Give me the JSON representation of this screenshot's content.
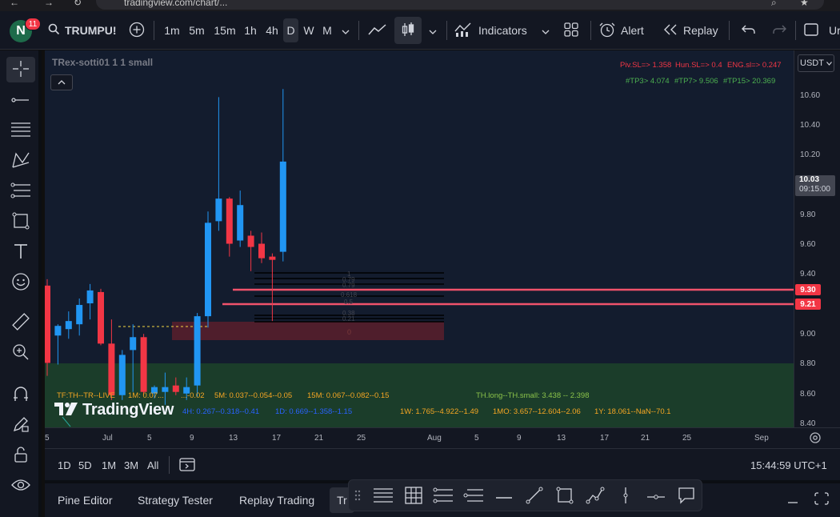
{
  "browser": {
    "url": "tradingview.com/chart/..."
  },
  "header": {
    "avatar_letter": "N",
    "notifications": "11",
    "symbol": "TRUMPU!",
    "intervals": [
      "1m",
      "5m",
      "15m",
      "1h",
      "4h",
      "D",
      "W",
      "M"
    ],
    "active_interval": "D",
    "indicators_label": "Indicators",
    "alert_label": "Alert",
    "replay_label": "Replay",
    "overflow_label": "Ur"
  },
  "chart": {
    "legend_title": "TRex-sotti01 1 1 small",
    "overlays": {
      "sl_line": [
        "Piv.SL=> 1.358",
        "Hun.SL=> 0.4",
        "ENG.sl=> 0.247"
      ],
      "tp_line": [
        "#TP3> 4.074",
        "#TP7> 9.506",
        "#TP15> 20.369"
      ],
      "tf_row1": [
        "TF:TH--TR--LIVE",
        "1M: 0.07...",
        "...-0.02",
        "5M: 0.037--0.054--0.05",
        "15M: 0.067--0.082--0.15",
        "TH.long--TH.small: 3.438 -- 2.398"
      ],
      "tf_row2": [
        "4H: 0.267--0.318--0.41",
        "1D: 0.669--1.358--1.15",
        "1W: 1.765--4.922--1.49",
        "1MO: 3.657--12.604--2.06",
        "1Y: 18.061--NaN--70.1"
      ],
      "fib_labels": [
        "1",
        "0.79",
        "0.79",
        "0.618",
        "0.5",
        "0.38",
        "0.21",
        "0"
      ]
    },
    "watermark": "TradingView",
    "price_axis": {
      "currency": "USDT",
      "ticks": [
        "10.60",
        "10.40",
        "10.20",
        "9.80",
        "9.60",
        "9.40",
        "9.00",
        "8.80",
        "8.60",
        "8.40"
      ],
      "current_price": "10.03",
      "current_time": "09:15:00",
      "tag_upper": "9.30",
      "tag_lower": "9.21"
    },
    "time_axis": [
      "5",
      "Jul",
      "5",
      "9",
      "13",
      "17",
      "21",
      "25",
      "Aug",
      "5",
      "9",
      "13",
      "17",
      "21",
      "25",
      "Sep"
    ]
  },
  "chart_data": {
    "type": "candlestick",
    "title": "",
    "ylim": [
      8.38,
      10.72
    ],
    "up_color": "#2196f3",
    "down_color": "#f23645",
    "candles": [
      {
        "o": 9.26,
        "h": 9.3,
        "l": 8.7,
        "c": 8.78
      },
      {
        "o": 8.95,
        "h": 9.02,
        "l": 8.77,
        "c": 9.01
      },
      {
        "o": 8.99,
        "h": 9.1,
        "l": 8.93,
        "c": 9.04
      },
      {
        "o": 9.02,
        "h": 9.18,
        "l": 8.95,
        "c": 9.14
      },
      {
        "o": 9.15,
        "h": 9.27,
        "l": 9.05,
        "c": 9.23
      },
      {
        "o": 9.22,
        "h": 9.24,
        "l": 8.89,
        "c": 8.9
      },
      {
        "o": 8.9,
        "h": 9.05,
        "l": 8.55,
        "c": 8.58
      },
      {
        "o": 8.58,
        "h": 8.86,
        "l": 8.55,
        "c": 8.83
      },
      {
        "o": 8.86,
        "h": 9.02,
        "l": 8.6,
        "c": 8.94
      },
      {
        "o": 8.94,
        "h": 8.96,
        "l": 8.58,
        "c": 8.6
      },
      {
        "o": 8.59,
        "h": 8.64,
        "l": 8.56,
        "c": 8.63
      },
      {
        "o": 8.6,
        "h": 8.72,
        "l": 8.52,
        "c": 8.63
      },
      {
        "o": 8.64,
        "h": 8.69,
        "l": 8.58,
        "c": 8.6
      },
      {
        "o": 8.59,
        "h": 8.69,
        "l": 8.55,
        "c": 8.63
      },
      {
        "o": 8.64,
        "h": 9.09,
        "l": 8.57,
        "c": 9.07
      },
      {
        "o": 9.07,
        "h": 9.72,
        "l": 9.0,
        "c": 9.65
      },
      {
        "o": 9.66,
        "h": 10.43,
        "l": 9.6,
        "c": 9.8
      },
      {
        "o": 9.8,
        "h": 9.81,
        "l": 9.44,
        "c": 9.52
      },
      {
        "o": 9.54,
        "h": 9.85,
        "l": 9.5,
        "c": 9.76
      },
      {
        "o": 9.57,
        "h": 9.6,
        "l": 9.35,
        "c": 9.5
      },
      {
        "o": 9.52,
        "h": 9.59,
        "l": 9.4,
        "c": 9.43
      },
      {
        "o": 9.44,
        "h": 9.46,
        "l": 9.04,
        "c": 9.42
      },
      {
        "o": 9.47,
        "h": 10.48,
        "l": 9.41,
        "c": 10.03
      }
    ]
  },
  "range_bar": {
    "ranges": [
      "1D",
      "5D",
      "1M",
      "3M",
      "All"
    ],
    "clock": "15:44:59 UTC+1"
  },
  "bottom_panel": {
    "tabs": [
      "Pine Editor",
      "Strategy Tester",
      "Replay Trading",
      "Tr"
    ]
  },
  "colors": {
    "background": "#131722",
    "accent": "#2962ff",
    "up": "#2196f3",
    "down": "#f23645",
    "green_zone": "#1b3d2a"
  }
}
